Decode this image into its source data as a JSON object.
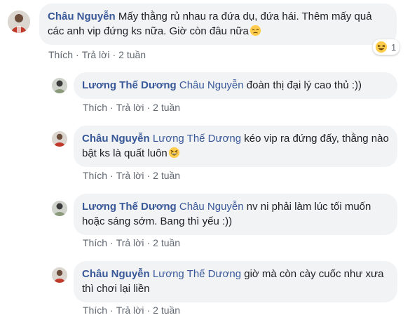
{
  "comments": [
    {
      "author": "Châu Nguyễn",
      "mention": "",
      "text": "Mấy thằng rủ nhau ra đứa dụ, đứa hái. Thêm mấy quả các anh vip đứng ks nữa. Giờ còn đâu nữa",
      "emoji": "pensive-face-icon",
      "actions": {
        "like": "Thích",
        "reply": "Trả lời",
        "time": "2 tuần"
      },
      "reaction": {
        "emoji": "laughing-face-icon",
        "count": "1"
      }
    },
    {
      "author": "Lương Thế Dương",
      "mention": "Châu Nguyễn",
      "text": "đoàn thị đại lý cao thủ :))",
      "actions": {
        "like": "Thích",
        "reply": "Trả lời",
        "time": "2 tuần"
      }
    },
    {
      "author": "Châu Nguyễn",
      "mention": "Lương Thế Dương",
      "text": "kéo vip ra đứng đấy, thằng nào bật ks là quất luôn",
      "emoji": "grinning-squinting-face-icon",
      "actions": {
        "like": "Thích",
        "reply": "Trả lời",
        "time": "2 tuần"
      }
    },
    {
      "author": "Lương Thế Dương",
      "mention": "Châu Nguyễn",
      "text": "nv ni phải làm lúc tối muốn hoặc sáng sớm. Bang thì yếu :))",
      "actions": {
        "like": "Thích",
        "reply": "Trả lời",
        "time": "2 tuần"
      }
    },
    {
      "author": "Châu Nguyễn",
      "mention": "Lương Thế Dương",
      "text": "giờ mà còn cày cuốc như xưa thì chơi lại liền",
      "actions": {
        "like": "Thích",
        "reply": "Trả lời",
        "time": "2 tuần"
      }
    }
  ],
  "colors": {
    "author": "#385898",
    "bubble": "#f2f3f5",
    "meta": "#606770",
    "emoji": "#ffcc4d"
  }
}
